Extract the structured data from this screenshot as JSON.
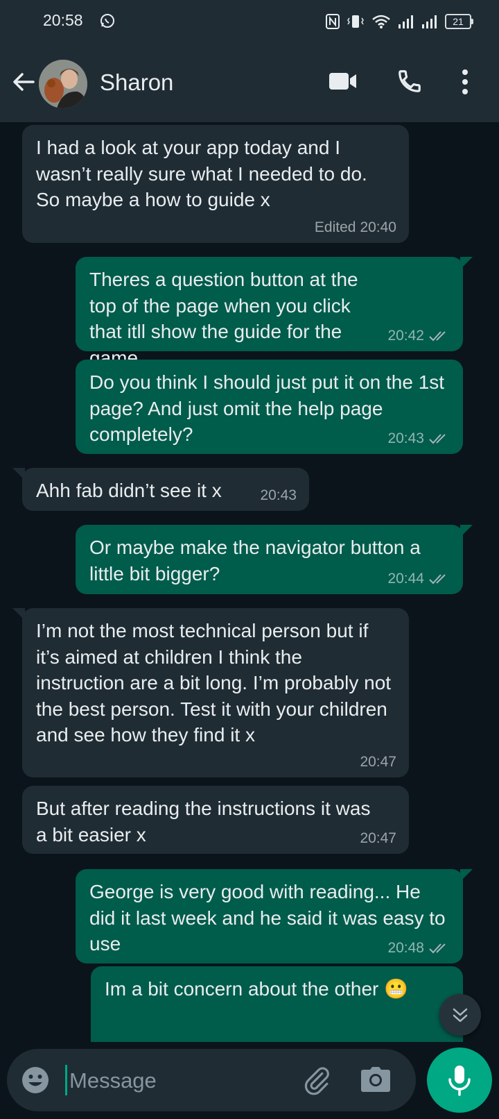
{
  "status_bar": {
    "time": "20:58",
    "battery": "21"
  },
  "header": {
    "contact_name": "Sharon"
  },
  "messages": [
    {
      "direction": "in",
      "text": "I had a look at your app today and I wasn’t really sure what I needed to do. So maybe a how to guide x",
      "edited_label": "Edited",
      "time": "20:40"
    },
    {
      "direction": "out",
      "text": "Theres a question button at the top of the page when you click that itll show the guide for the game.",
      "time": "20:42",
      "status": "delivered"
    },
    {
      "direction": "out",
      "text": "Do you think I should just put it on the 1st page? And just omit the help page completely?",
      "time": "20:43",
      "status": "delivered"
    },
    {
      "direction": "in",
      "text": "Ahh fab didn’t see it x",
      "time": "20:43"
    },
    {
      "direction": "out",
      "text": "Or maybe make the navigator button a little bit bigger?",
      "time": "20:44",
      "status": "delivered"
    },
    {
      "direction": "in",
      "text": "I’m not the most technical person but if it’s aimed at children I think the instruction are a bit long. I’m probably not the best person. Test it with your children and see how they find it x",
      "time": "20:47"
    },
    {
      "direction": "in",
      "text": "But after reading the instructions it was a bit easier x",
      "time": "20:47"
    },
    {
      "direction": "out",
      "text": "George is very good with reading... He did it last week and he said it was easy to use",
      "time": "20:48",
      "status": "delivered"
    },
    {
      "direction": "out",
      "text": "Im a bit concern about the other 😬",
      "time": "",
      "status": ""
    }
  ],
  "composer": {
    "placeholder": "Message",
    "value": ""
  },
  "colors": {
    "incoming_bubble": "#1f2c34",
    "outgoing_bubble": "#005c4b",
    "accent": "#00a884",
    "background": "#0b141a"
  }
}
